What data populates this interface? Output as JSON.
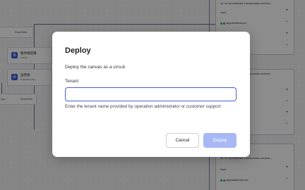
{
  "canvas": {
    "nodes": [
      {
        "title": "服务端逻辑",
        "subtitle": "admin"
      },
      {
        "title": "运营组",
        "subtitle": "business-day"
      }
    ],
    "labels": {
      "read_write_1": "Read/Write",
      "day": "day",
      "read_write_2": "Read/Write"
    },
    "panels": [
      {
        "url": "dir: s3: ap-northeast-1.amazonaws.com/exa...",
        "input": "Input",
        "file": "/app/dataMeta.csv",
        "extra": "employed.csv"
      },
      {
        "url": "dir: s3: ap-northeast-1.amazonaws.com/exa...",
        "input": "Input",
        "file": "/app/dataSource.csv",
        "extra": "/app/data.csv"
      },
      {
        "url": "dir: s3: ap-northeast-1.amazonaws.com/exa...",
        "input": "Input",
        "file": "/app/dataResult.csv",
        "extra": ""
      }
    ]
  },
  "dialog": {
    "title": "Deploy",
    "description": "Deploy the canvas as a circuit.",
    "tenant_label": "Tenant",
    "tenant_value": "",
    "tenant_placeholder": "",
    "help": "Enter the tenant name provided by operation administrator or customer support",
    "cancel_label": "Cancel",
    "deploy_label": "Deploy",
    "deploy_enabled": false,
    "accent_color": "#4561d6",
    "deploy_disabled_color": "#a7b8f4"
  }
}
